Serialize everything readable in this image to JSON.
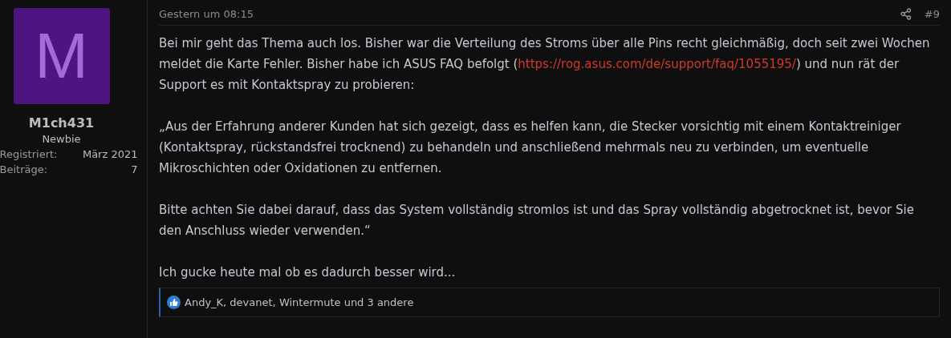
{
  "author": {
    "avatar_letter": "M",
    "name": "M1ch431",
    "rank": "Newbie",
    "stats": [
      {
        "label": "Registriert:",
        "value": "März 2021"
      },
      {
        "label": "Beiträge:",
        "value": "7"
      }
    ]
  },
  "post": {
    "date": "Gestern um 08:15",
    "number": "#9",
    "paragraphs": [
      {
        "kind": "link",
        "before": "Bei mir geht das Thema auch los. Bisher war die Verteilung des Stroms über alle Pins recht gleichmäßig, doch seit zwei Wochen meldet die Karte Fehler. Bisher habe ich ASUS FAQ befolgt (",
        "link": "https://rog.asus.com/de/support/faq/1055195/",
        "after": ") und nun rät der Support es mit Kontaktspray zu probieren:"
      },
      {
        "kind": "text",
        "text": "„Aus der Erfahrung anderer Kunden hat sich gezeigt, dass es helfen kann, die Stecker vorsichtig mit einem Kontaktreiniger (Kontaktspray, rückstandsfrei trocknend) zu behandeln und anschließend mehrmals neu zu verbinden, um eventuelle Mikroschichten oder Oxidationen zu entfernen."
      },
      {
        "kind": "text",
        "text": "Bitte achten Sie dabei darauf, dass das System vollständig stromlos ist und das Spray vollständig abgetrocknet ist, bevor Sie den Anschluss wieder verwenden.“"
      },
      {
        "kind": "text",
        "text": "Ich gucke heute mal ob es dadurch besser wird..."
      }
    ],
    "reactions": "Andy_K, devanet, Wintermute und 3 andere"
  }
}
